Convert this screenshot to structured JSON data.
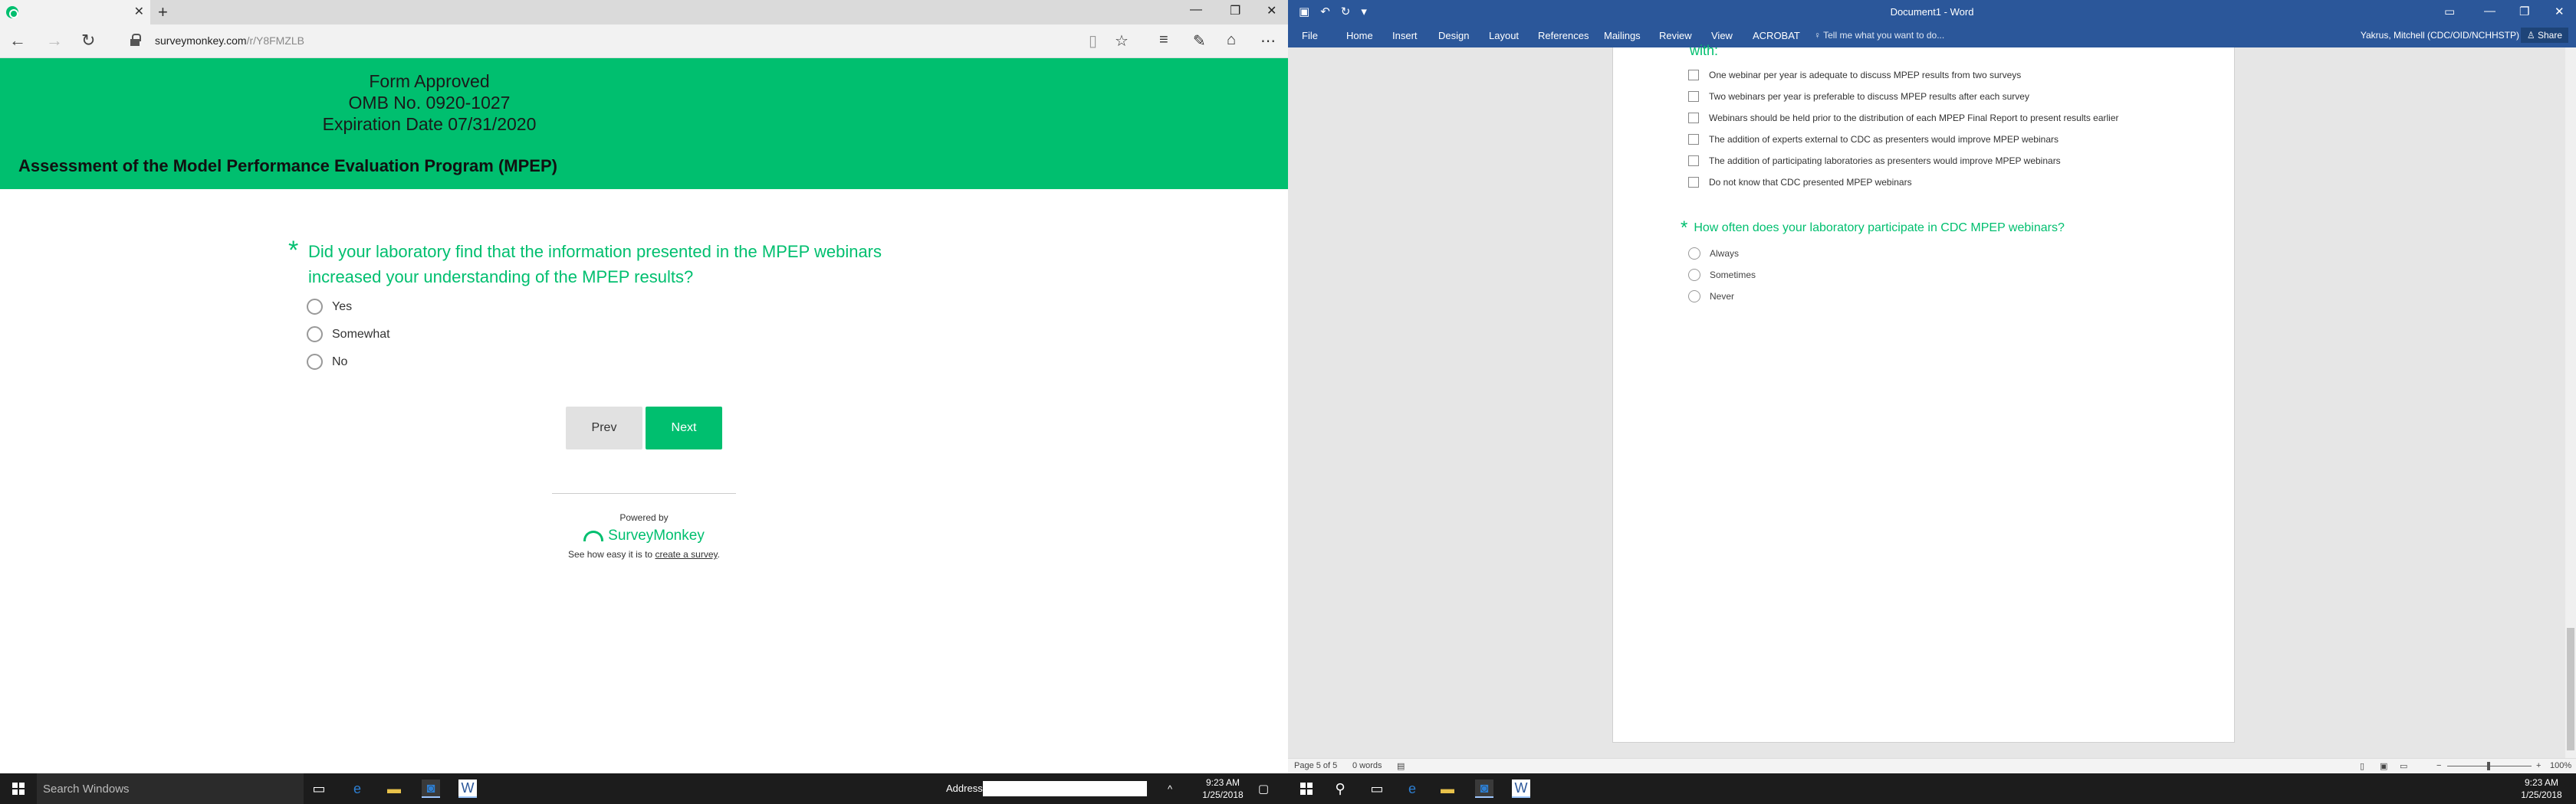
{
  "browser": {
    "tab_close": "✕",
    "new_tab": "+",
    "url_host": "surveymonkey.com",
    "url_path": "/r/Y8FMZLB"
  },
  "survey": {
    "approval_line1": "Form Approved",
    "approval_line2": "OMB No. 0920-1027",
    "approval_line3": "Expiration Date 07/31/2020",
    "title": "Assessment of the Model Performance Evaluation Program (MPEP)",
    "question_star": "*",
    "question_line1": "Did your laboratory find that the information presented in the MPEP webinars",
    "question_line2": "increased your understanding of the MPEP results?",
    "options": [
      "Yes",
      "Somewhat",
      "No"
    ],
    "prev_label": "Prev",
    "next_label": "Next",
    "powered_by": "Powered by",
    "brand": "SurveyMonkey",
    "see_how": "See how easy it is to",
    "create_link": "create a survey",
    "period": "."
  },
  "taskbar_left": {
    "search_placeholder": "Search Windows",
    "address_label": "Address",
    "time": "9:23 AM",
    "date": "1/25/2018"
  },
  "word": {
    "window_title": "Document1 - Word",
    "ribbon_tabs": [
      "File",
      "Home",
      "Insert",
      "Design",
      "Layout",
      "References",
      "Mailings",
      "Review",
      "View",
      "ACROBAT"
    ],
    "tell_me": "Tell me what you want to do...",
    "user": "Yakrus, Mitchell (CDC/OID/NCHHSTP)",
    "share": "Share",
    "cut_text": "with:",
    "checkbox_items": [
      "One webinar per year is adequate to discuss MPEP results from two surveys",
      "Two webinars per year is preferable to discuss MPEP results after each survey",
      "Webinars should be held prior to the distribution of each MPEP Final Report to present results earlier",
      "The addition of experts external to CDC as presenters would improve MPEP webinars",
      "The addition of participating laboratories as presenters would improve MPEP webinars",
      "Do not know that CDC presented MPEP webinars"
    ],
    "question_star": "*",
    "question": "How often does your laboratory participate in CDC MPEP webinars?",
    "options": [
      "Always",
      "Sometimes",
      "Never"
    ],
    "status_page": "Page 5 of 5",
    "status_words": "0 words",
    "zoom_minus": "−",
    "zoom_plus": "+",
    "zoom": "100%"
  },
  "taskbar_right": {
    "time": "9:23 AM",
    "date": "1/25/2018"
  },
  "colors": {
    "sm_green": "#00bf6f",
    "word_blue": "#2b579a",
    "taskbar": "#1c1c1c"
  }
}
